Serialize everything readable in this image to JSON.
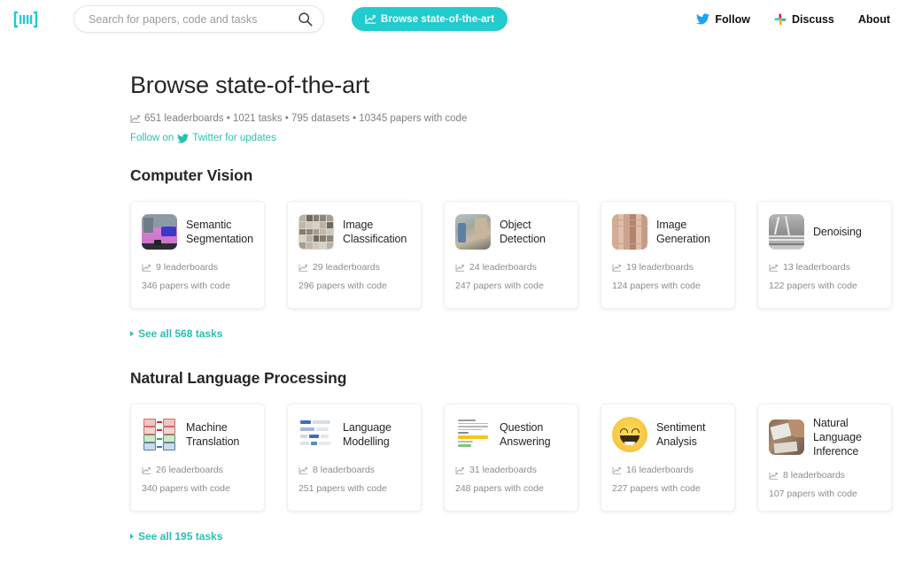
{
  "header": {
    "logo_name": "papers-with-code-logo",
    "search": {
      "placeholder": "Search for papers, code and tasks",
      "value": "",
      "icon": "search-icon"
    },
    "sota_button": {
      "label": "Browse state-of-the-art",
      "icon": "chart-line-icon",
      "color": "#21cbce"
    },
    "links": [
      {
        "label": "Follow",
        "icon": "twitter-icon"
      },
      {
        "label": "Discuss",
        "icon": "slack-icon"
      },
      {
        "label": "About",
        "icon": ""
      }
    ]
  },
  "page": {
    "title": "Browse state-of-the-art",
    "stats_icon": "chart-line-icon",
    "stats": "651 leaderboards • 1021 tasks • 795 datasets • 10345 papers with code",
    "follow_prefix": "Follow on",
    "follow_icon": "twitter-icon",
    "follow_suffix": "Twitter for updates",
    "accent_color": "#2bbfb3"
  },
  "sections": [
    {
      "title": "Computer Vision",
      "see_all": "See all 568 tasks",
      "cards": [
        {
          "name": "Semantic Segmentation",
          "leaderboards": "9 leaderboards",
          "papers": "346 papers with code",
          "thumb": "semantic-segmentation-thumbnail"
        },
        {
          "name": "Image Classification",
          "leaderboards": "29 leaderboards",
          "papers": "296 papers with code",
          "thumb": "image-classification-thumbnail"
        },
        {
          "name": "Object Detection",
          "leaderboards": "24 leaderboards",
          "papers": "247 papers with code",
          "thumb": "object-detection-thumbnail"
        },
        {
          "name": "Image Generation",
          "leaderboards": "19 leaderboards",
          "papers": "124 papers with code",
          "thumb": "image-generation-thumbnail"
        },
        {
          "name": "Denoising",
          "leaderboards": "13 leaderboards",
          "papers": "122 papers with code",
          "thumb": "denoising-thumbnail"
        }
      ]
    },
    {
      "title": "Natural Language Processing",
      "see_all": "See all 195 tasks",
      "cards": [
        {
          "name": "Machine Translation",
          "leaderboards": "26 leaderboards",
          "papers": "340 papers with code",
          "thumb": "machine-translation-thumbnail"
        },
        {
          "name": "Language Modelling",
          "leaderboards": "8 leaderboards",
          "papers": "251 papers with code",
          "thumb": "language-modelling-thumbnail"
        },
        {
          "name": "Question Answering",
          "leaderboards": "31 leaderboards",
          "papers": "248 papers with code",
          "thumb": "question-answering-thumbnail"
        },
        {
          "name": "Sentiment Analysis",
          "leaderboards": "16 leaderboards",
          "papers": "227 papers with code",
          "thumb": "sentiment-analysis-thumbnail"
        },
        {
          "name": "Natural Language Inference",
          "leaderboards": "8 leaderboards",
          "papers": "107 papers with code",
          "thumb": "natural-language-inference-thumbnail"
        }
      ]
    }
  ]
}
